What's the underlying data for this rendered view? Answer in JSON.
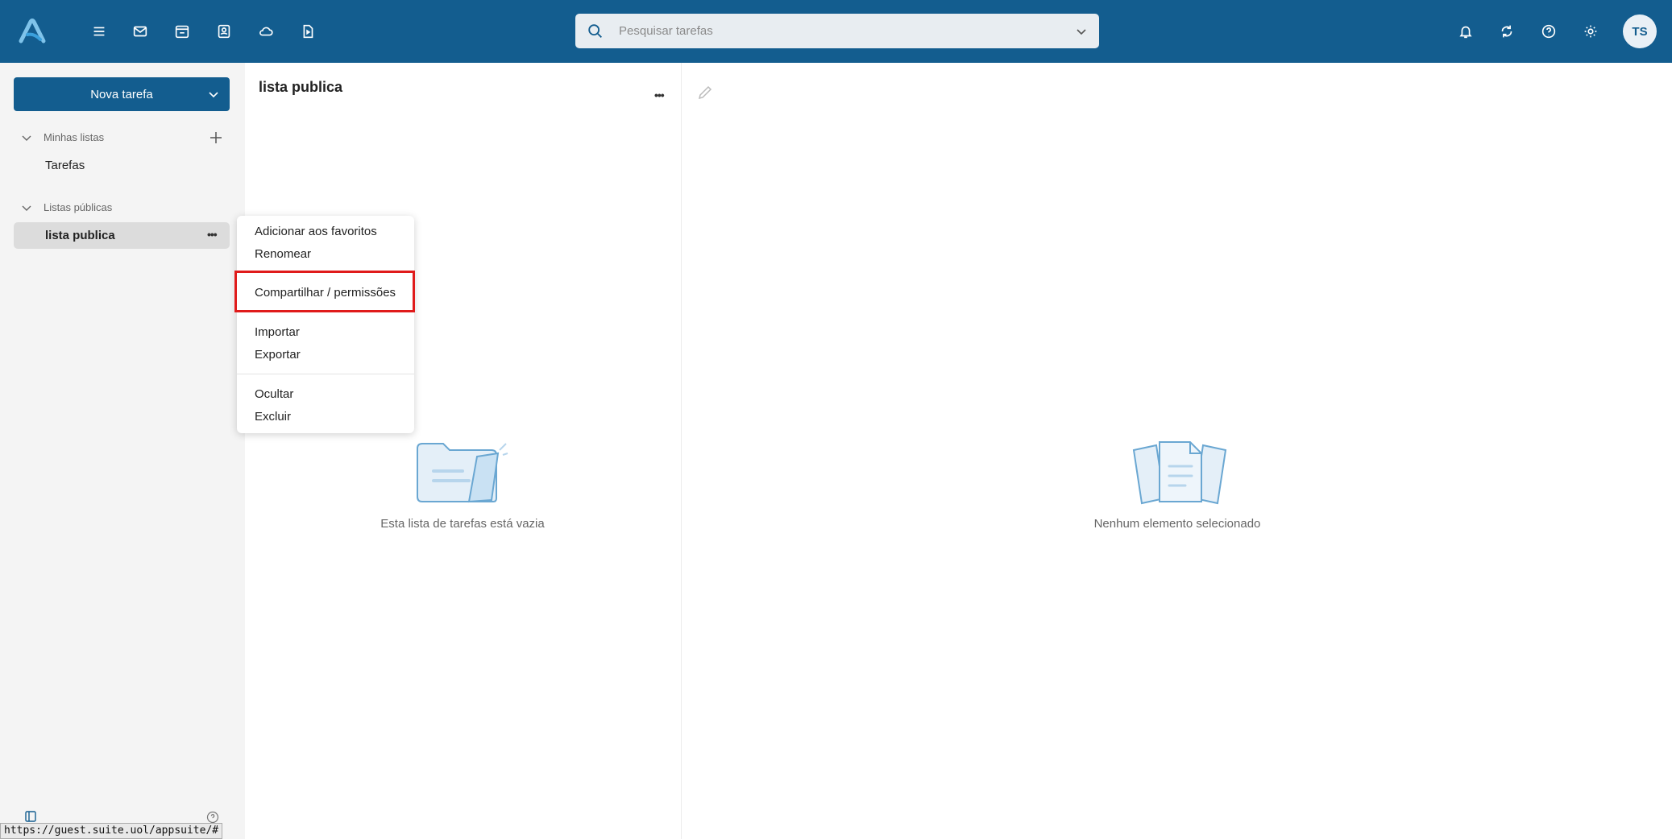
{
  "topbar": {
    "icons": [
      "hamburger-menu-icon",
      "mail-icon",
      "calendar-icon",
      "contacts-icon",
      "cloud-drive-icon",
      "portal-icon"
    ],
    "search_placeholder": "Pesquisar tarefas",
    "right_icons": [
      "bell-icon",
      "refresh-icon",
      "help-icon",
      "gear-icon"
    ],
    "avatar_initials": "TS",
    "accent": "#135d8f"
  },
  "sidebar": {
    "new_task_label": "Nova tarefa",
    "my_lists_label": "Minhas listas",
    "my_lists": [
      "Tarefas"
    ],
    "public_lists_label": "Listas públicas",
    "public_lists": [
      "lista publica"
    ]
  },
  "list": {
    "title": "lista publica",
    "empty_text": "Esta lista de tarefas está vazia"
  },
  "detail": {
    "empty_text": "Nenhum elemento selecionado"
  },
  "context_menu": {
    "add_favorites": "Adicionar aos favoritos",
    "rename": "Renomear",
    "share": "Compartilhar / permissões",
    "import": "Importar",
    "export": "Exportar",
    "hide": "Ocultar",
    "delete": "Excluir",
    "highlight_color": "#e01b1b"
  },
  "status_url": "https://guest.suite.uol/appsuite/#"
}
